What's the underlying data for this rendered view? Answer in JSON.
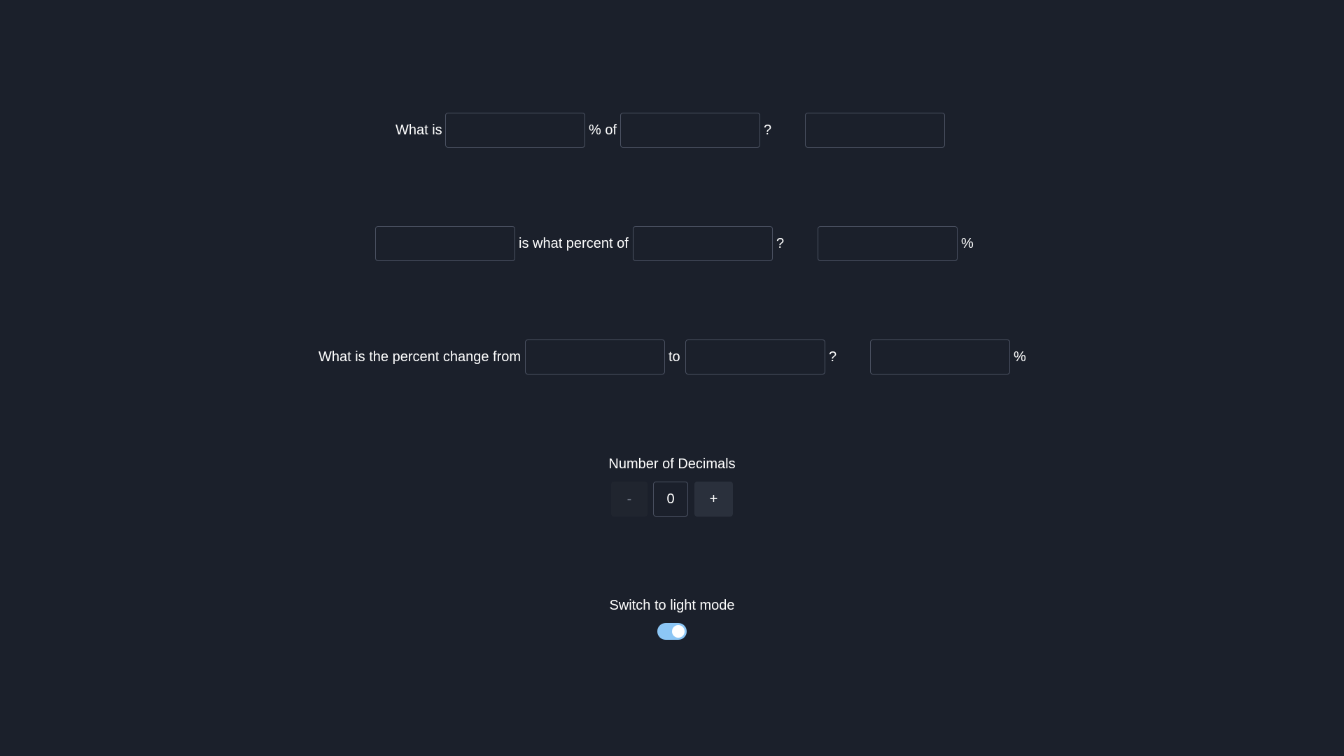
{
  "row1": {
    "prefix": "What is",
    "middle": "% of",
    "question": "?",
    "percent_input": "",
    "of_input": "",
    "result": ""
  },
  "row2": {
    "middle": "is what percent of",
    "question": "?",
    "suffix": "%",
    "part_input": "",
    "whole_input": "",
    "result": ""
  },
  "row3": {
    "prefix": "What is the percent change from",
    "middle": "to",
    "question": "?",
    "suffix": "%",
    "from_input": "",
    "to_input": "",
    "result": ""
  },
  "decimals": {
    "label": "Number of Decimals",
    "decrement_label": "-",
    "increment_label": "+",
    "value": "0"
  },
  "theme": {
    "label": "Switch to light mode",
    "toggle_on": true,
    "toggle_color": "#8cc6f5"
  },
  "colors": {
    "background": "#1b202b",
    "border": "#4a5161",
    "button": "#2a303c"
  }
}
